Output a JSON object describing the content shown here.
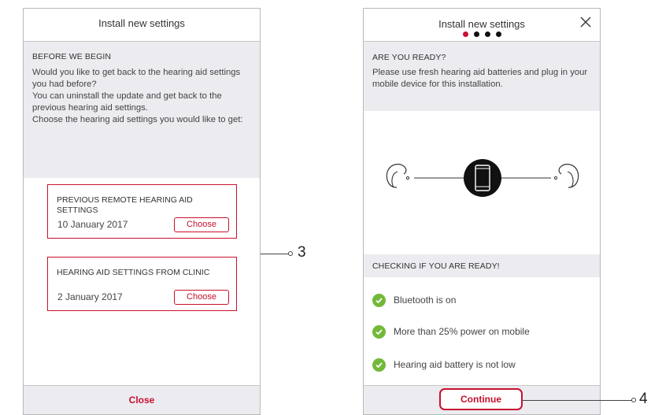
{
  "left_screen": {
    "title": "Install new settings",
    "section_title": "BEFORE WE BEGIN",
    "description": "Would you like to get back to the hearing aid settings you had before?\nYou can uninstall the update and get back to the previous hearing aid settings.\nChoose the hearing aid settings you would like to get:",
    "cards": [
      {
        "title": "PREVIOUS REMOTE HEARING AID SETTINGS",
        "date": "10 January 2017",
        "button": "Choose"
      },
      {
        "title": "HEARING AID SETTINGS FROM CLINIC",
        "date": "2 January 2017",
        "button": "Choose"
      }
    ],
    "footer_button": "Close"
  },
  "right_screen": {
    "title": "Install new settings",
    "pagination": {
      "total": 4,
      "current": 1
    },
    "section_title": "ARE YOU READY?",
    "description": "Please use fresh hearing aid batteries and plug in your mobile device for this installation.",
    "illustration_icons": [
      "hearing-aid-left-icon",
      "smartphone-icon",
      "hearing-aid-right-icon"
    ],
    "checks_title": "CHECKING IF YOU ARE READY!",
    "checks": [
      {
        "label": "Bluetooth is on",
        "status": "ok"
      },
      {
        "label": "More than 25% power on mobile",
        "status": "ok"
      },
      {
        "label": "Hearing aid battery is not low",
        "status": "ok"
      }
    ],
    "footer_button": "Continue"
  },
  "callouts": {
    "left": "3",
    "right": "4"
  },
  "colors": {
    "accent": "#c8102e",
    "success": "#74b83a",
    "panel": "#ebebf0"
  }
}
